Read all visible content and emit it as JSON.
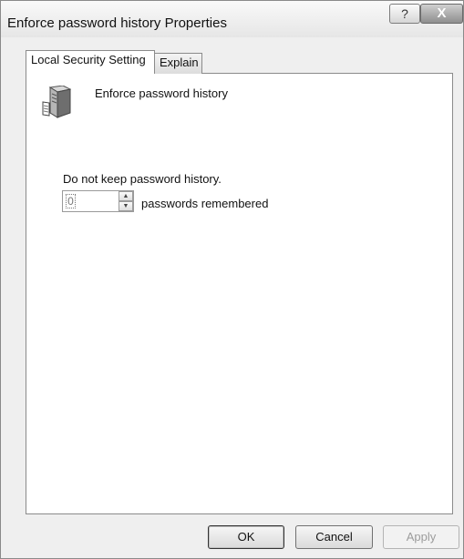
{
  "window": {
    "title": "Enforce password history Properties",
    "help_glyph": "?",
    "close_glyph": "X"
  },
  "tabs": [
    {
      "label": "Local Security Setting",
      "selected": true
    },
    {
      "label": "Explain",
      "selected": false
    }
  ],
  "policy": {
    "icon": "server-icon",
    "name": "Enforce password history"
  },
  "setting": {
    "status_text": "Do not keep password history.",
    "value": "0",
    "suffix": "passwords remembered"
  },
  "buttons": {
    "ok": "OK",
    "cancel": "Cancel",
    "apply": "Apply"
  },
  "colors": {
    "close_button": "#8e8e8e",
    "panel": "#ffffff",
    "disabled_text": "#9c9c9c"
  }
}
